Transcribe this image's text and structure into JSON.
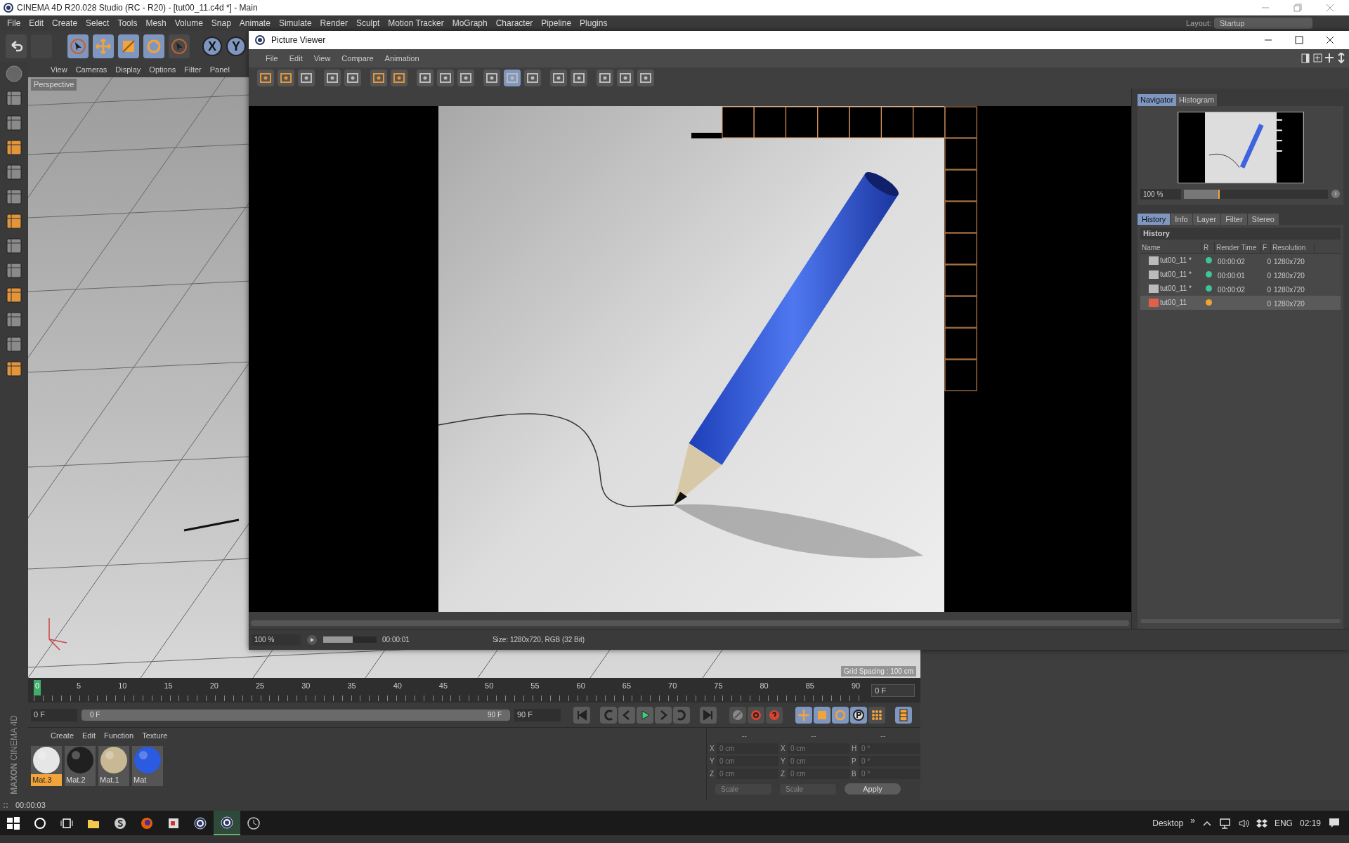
{
  "app_title": "CINEMA 4D R20.028 Studio (RC - R20) - [tut00_11.c4d *] - Main",
  "main_menu": [
    "File",
    "Edit",
    "Create",
    "Select",
    "Tools",
    "Mesh",
    "Volume",
    "Snap",
    "Animate",
    "Simulate",
    "Render",
    "Sculpt",
    "Motion Tracker",
    "MoGraph",
    "Character",
    "Pipeline",
    "Plugins"
  ],
  "layout": {
    "label": "Layout:",
    "value": "Startup"
  },
  "axis_buttons": [
    "X",
    "Y"
  ],
  "viewport": {
    "menu": [
      "View",
      "Cameras",
      "Display",
      "Options",
      "Filter",
      "Panel"
    ],
    "label": "Perspective",
    "grid_spacing": "Grid Spacing : 100 cm"
  },
  "picture_viewer": {
    "title": "Picture Viewer",
    "menu": [
      "File",
      "Edit",
      "View",
      "Compare",
      "Animation"
    ],
    "nav_tabs": [
      {
        "label": "Navigator",
        "selected": true
      },
      {
        "label": "Histogram",
        "selected": false
      }
    ],
    "nav_zoom": "100 %",
    "nav_slider": {
      "level": 0.25
    },
    "side_tabs": [
      {
        "label": "History",
        "selected": true
      },
      {
        "label": "Info",
        "selected": false
      },
      {
        "label": "Layer",
        "selected": false
      },
      {
        "label": "Filter",
        "selected": false
      },
      {
        "label": "Stereo",
        "selected": false
      }
    ],
    "history_heading": "History",
    "columns": [
      "Name",
      "R",
      "Render Time",
      "F",
      "Resolution"
    ],
    "rows": [
      {
        "name": "tut00_11 *",
        "color": "#3fc49a",
        "time": "00:00:02",
        "frame": "0",
        "resolution": "1280x720",
        "selected": false
      },
      {
        "name": "tut00_11 *",
        "color": "#3fc49a",
        "time": "00:00:01",
        "frame": "0",
        "resolution": "1280x720",
        "selected": false
      },
      {
        "name": "tut00_11 *",
        "color": "#3fc49a",
        "time": "00:00:02",
        "frame": "0",
        "resolution": "1280x720",
        "selected": false
      },
      {
        "name": "tut00_11",
        "color": "#f0a430",
        "frame": "0",
        "resolution": "1280x720",
        "selected": true
      }
    ],
    "zoom": "100 %",
    "progress": {
      "level": 0.55
    },
    "time": "00:00:01",
    "size": "Size: 1280x720, RGB (32 Bit)"
  },
  "timeline": {
    "ticks": [
      {
        "label": "0",
        "selected": true
      },
      {
        "label": "5",
        "selected": false
      },
      {
        "label": "10",
        "selected": false
      },
      {
        "label": "15",
        "selected": false
      },
      {
        "label": "20",
        "selected": false
      },
      {
        "label": "25",
        "selected": false
      },
      {
        "label": "30",
        "selected": false
      },
      {
        "label": "35",
        "selected": false
      },
      {
        "label": "40",
        "selected": false
      },
      {
        "label": "45",
        "selected": false
      },
      {
        "label": "50",
        "selected": false
      },
      {
        "label": "55",
        "selected": false
      },
      {
        "label": "60",
        "selected": false
      },
      {
        "label": "65",
        "selected": false
      },
      {
        "label": "70",
        "selected": false
      },
      {
        "label": "75",
        "selected": false
      },
      {
        "label": "80",
        "selected": false
      },
      {
        "label": "85",
        "selected": false
      },
      {
        "label": "90",
        "selected": false
      }
    ],
    "frame_field": "0 F"
  },
  "transport": {
    "range": {
      "level": 1
    },
    "start": "0 F",
    "range_start": "0 F",
    "range_end": "90 F",
    "end": "90 F"
  },
  "materials": {
    "menu": [
      "Create",
      "Edit",
      "Function",
      "Texture"
    ],
    "items": [
      {
        "name": "Mat.3",
        "color": "#e6e6e6",
        "selected": true
      },
      {
        "name": "Mat.2",
        "color": "#202020",
        "selected": false
      },
      {
        "name": "Mat.1",
        "color": "#c8b894",
        "selected": false
      },
      {
        "name": "Mat",
        "color": "#2a5be0",
        "selected": false
      }
    ]
  },
  "coordinates": {
    "headers": [
      "--",
      "--",
      "--"
    ],
    "rows": [
      [
        {
          "axis": "X",
          "value": "0 cm"
        },
        {
          "axis": "X",
          "value": "0 cm"
        },
        {
          "axis": "H",
          "value": "0 °"
        }
      ],
      [
        {
          "axis": "Y",
          "value": "0 cm"
        },
        {
          "axis": "Y",
          "value": "0 cm"
        },
        {
          "axis": "P",
          "value": "0 °"
        }
      ],
      [
        {
          "axis": "Z",
          "value": "0 cm"
        },
        {
          "axis": "Z",
          "value": "0 cm"
        },
        {
          "axis": "B",
          "value": "0 °"
        }
      ]
    ],
    "modes": [
      "Scale",
      "Scale"
    ],
    "apply": "Apply"
  },
  "logo": [
    "MAXON",
    "CINEMA 4D"
  ],
  "status": "00:00:03",
  "taskbar": {
    "desktop": "Desktop",
    "chevron": "»",
    "language": "ENG",
    "clock": "02:19"
  }
}
